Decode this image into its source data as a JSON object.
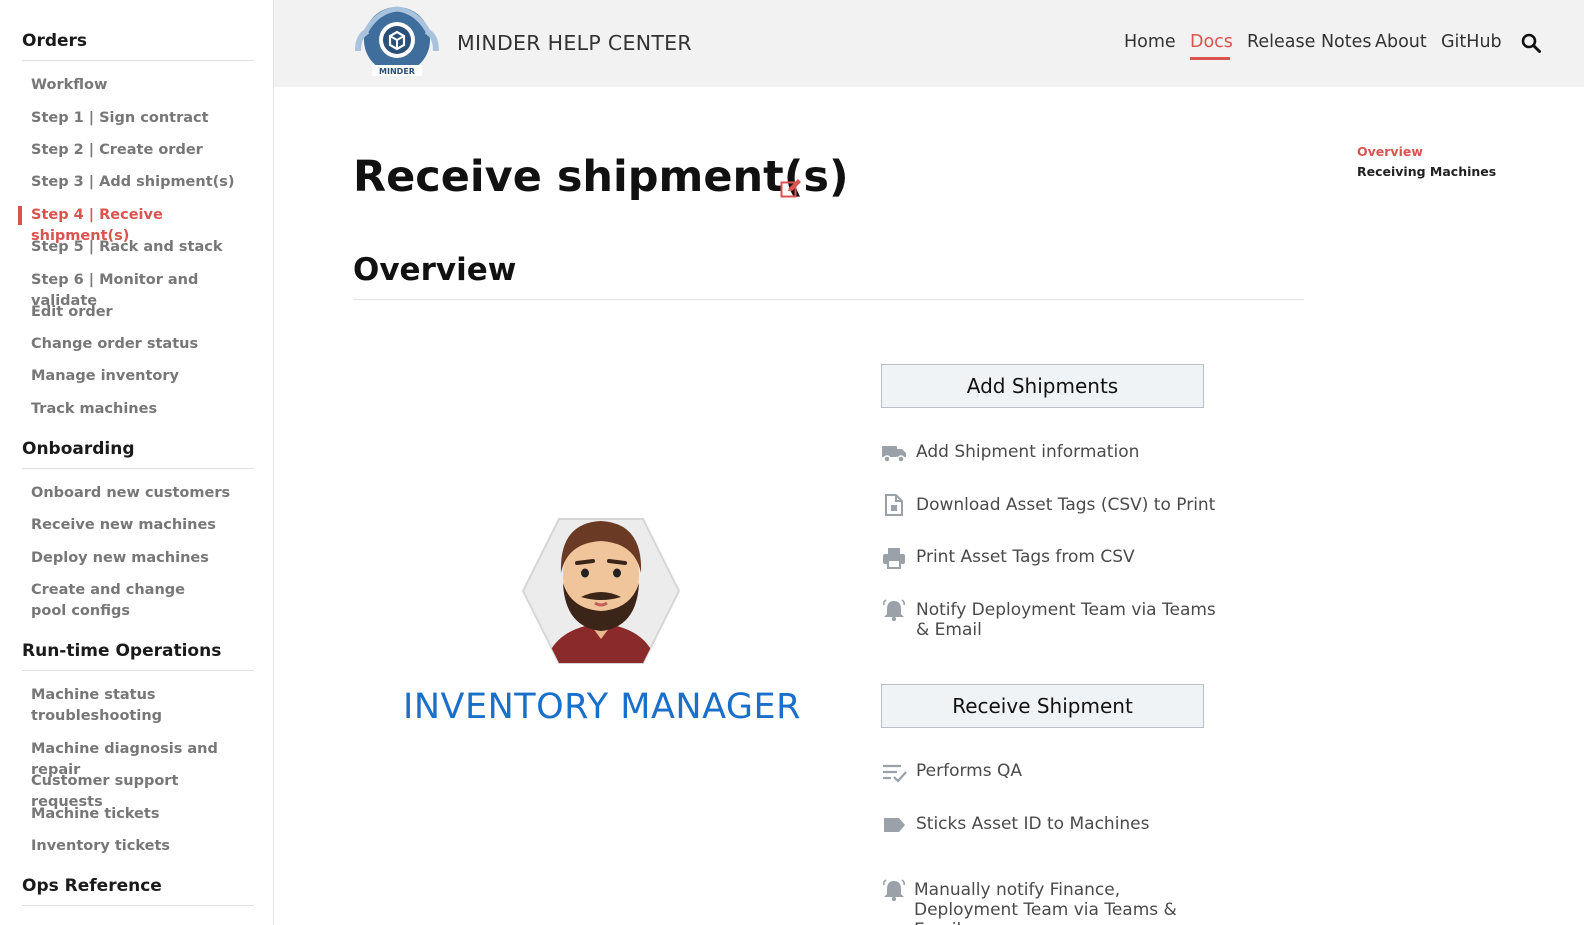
{
  "sidebar": {
    "sections": [
      {
        "heading": "Orders",
        "items": [
          "Workflow",
          "Step 1 | Sign contract",
          "Step 2 | Create order",
          "Step 3 | Add shipment(s)",
          "Step 4 | Receive shipment(s)",
          "Step 5 | Rack and stack",
          "Step 6 | Monitor and validate",
          "Edit order",
          "Change order status",
          "Manage inventory",
          "Track machines"
        ]
      },
      {
        "heading": "Onboarding",
        "items": [
          "Onboard new customers",
          "Receive new machines",
          "Deploy new machines",
          "Create and change pool configs"
        ]
      },
      {
        "heading": "Run-time Operations",
        "items": [
          "Machine status troubleshooting",
          "Machine diagnosis and repair",
          "Customer support requests",
          "Machine tickets",
          "Inventory tickets"
        ]
      },
      {
        "heading": "Ops Reference",
        "items": []
      }
    ],
    "active_item": "Step 4 | Receive shipment(s)"
  },
  "header": {
    "logo_text": "MINDER",
    "title": "MINDER HELP CENTER",
    "nav": [
      "Home",
      "Docs",
      "Release Notes",
      "About",
      "GitHub"
    ],
    "active_nav": "Docs"
  },
  "page": {
    "title": "Receive shipment(s)",
    "section_title": "Overview"
  },
  "toc": {
    "items": [
      "Overview",
      "Receiving Machines"
    ],
    "active": "Overview"
  },
  "persona": {
    "role": "INVENTORY MANAGER"
  },
  "panels": [
    {
      "title": "Add Shipments",
      "actions": [
        {
          "label": "Add Shipment information",
          "icon": "truck-icon"
        },
        {
          "label": "Download Asset Tags (CSV) to Print",
          "icon": "file-icon"
        },
        {
          "label": "Print Asset Tags from CSV",
          "icon": "printer-icon"
        },
        {
          "label": "Notify Deployment Team via Teams & Email",
          "icon": "bell-icon"
        }
      ]
    },
    {
      "title": "Receive Shipment",
      "actions": [
        {
          "label": "Performs QA",
          "icon": "checklist-icon"
        },
        {
          "label": "Sticks Asset ID to Machines",
          "icon": "tag-icon"
        },
        {
          "label": "Manually notify Finance, Deployment Team via Teams & Email",
          "icon": "bell-icon"
        }
      ]
    }
  ],
  "colors": {
    "accent": "#d9534f",
    "role_blue": "#1a6fc9",
    "header_bg": "#f2f2f2"
  }
}
